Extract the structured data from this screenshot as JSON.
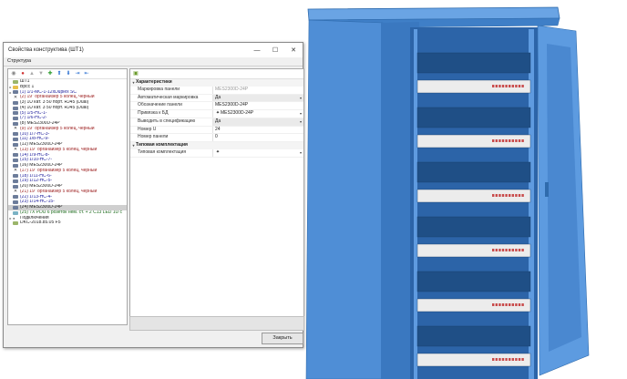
{
  "window": {
    "title": "Свойства конструктива (ШТ1)",
    "minimize": "—",
    "maximize": "☐",
    "close": "✕",
    "section": "Структура",
    "close_button": "Закрыть"
  },
  "tree": [
    {
      "tog": "",
      "ico": "doc",
      "text": "ШТ1",
      "color": "#222222"
    },
    {
      "tog": "▸",
      "ico": "folder",
      "text": "Врсс 1",
      "color": "#222222"
    },
    {
      "tog": "▸",
      "ico": "rack",
      "text": "(1) 1/1-МС-1-12xDuplex SC",
      "color": "#1a1a9a"
    },
    {
      "tog": "",
      "ico": "x",
      "text": "(2) 19\" органайзер 5 колец, черный",
      "color": "#9a1a1a"
    },
    {
      "tog": "",
      "ico": "rack",
      "text": "(3) 1U кат. 3 50 порт. RJ45 (Dual)",
      "color": "#222222"
    },
    {
      "tog": "",
      "ico": "rack",
      "text": "(4) 1U кат. 3 50 порт. RJ45 (Dual)",
      "color": "#222222"
    },
    {
      "tog": "",
      "ico": "rack",
      "text": "(5) 1/5-НС-1-",
      "color": "#1a1a9a"
    },
    {
      "tog": "",
      "ico": "rack",
      "text": "(7) 1/6-НС-2-",
      "color": "#1a1a9a"
    },
    {
      "tog": "",
      "ico": "rack",
      "text": "(8) MES2300D-24P",
      "color": "#222222"
    },
    {
      "tog": "",
      "ico": "x",
      "text": "(9) 19\" органайзер 5 колец, черный",
      "color": "#9a1a1a"
    },
    {
      "tog": "",
      "ico": "rack",
      "text": "(10) 1/7-НС-3-",
      "color": "#1a1a9a"
    },
    {
      "tog": "",
      "ico": "rack",
      "text": "(11) 1/8-НС-9-",
      "color": "#1a1a9a"
    },
    {
      "tog": "",
      "ico": "rack",
      "text": "(12) MES2300D-24P",
      "color": "#222222"
    },
    {
      "tog": "",
      "ico": "x",
      "text": "(13) 19\" органайзер 5 колец, черный",
      "color": "#9a1a1a"
    },
    {
      "tog": "",
      "ico": "rack",
      "text": "(14) 1/9-НС-8-",
      "color": "#1a1a9a"
    },
    {
      "tog": "",
      "ico": "rack",
      "text": "(15) 1/10-НС-7-",
      "color": "#1a1a9a"
    },
    {
      "tog": "",
      "ico": "rack",
      "text": "(16) MES2300D-24P",
      "color": "#222222"
    },
    {
      "tog": "",
      "ico": "x",
      "text": "(17) 19\" органайзер 5 колец, черный",
      "color": "#9a1a1a"
    },
    {
      "tog": "",
      "ico": "rack",
      "text": "(18) 1/11-НС-6-",
      "color": "#1a1a9a"
    },
    {
      "tog": "",
      "ico": "rack",
      "text": "(19) 1/12-НС-5-",
      "color": "#1a1a9a"
    },
    {
      "tog": "",
      "ico": "rack",
      "text": "(20) MES2300D-24P",
      "color": "#222222"
    },
    {
      "tog": "",
      "ico": "x",
      "text": "(21) 19\" органайзер 5 колец, черный",
      "color": "#9a1a1a"
    },
    {
      "tog": "",
      "ico": "rack",
      "text": "(22) 1/13-НС-4-",
      "color": "#1a1a9a"
    },
    {
      "tog": "",
      "ico": "rack",
      "text": "(23) 1/14-НС-15-",
      "color": "#1a1a9a"
    },
    {
      "tog": "",
      "ico": "rack",
      "text": "(24) MES2300D-24P",
      "color": "#222222",
      "selected": true
    },
    {
      "tog": "",
      "ico": "pdu",
      "text": "(25) 7X PDU 6 розеток нем. ст. + 2 C13 LED 1U с",
      "color": "#1a6a1a"
    },
    {
      "tog": "▸",
      "ico": "conn",
      "text": "Подключения",
      "color": "#222222"
    },
    {
      "tog": "",
      "ico": "doc",
      "text": "DKC-2018.85.05 F5",
      "color": "#222222"
    }
  ],
  "properties": {
    "section1": "Характеристики",
    "section2": "Типовая комплектация",
    "rows": [
      {
        "name": "Маркировка панели",
        "value": "MES2300D-24P",
        "readonly": true
      },
      {
        "name": "Автоматическая маркировка",
        "value": "Да",
        "combo": true,
        "arrow": true
      },
      {
        "name": "Обозначение панели",
        "value": "MES2300D-24P"
      },
      {
        "name": "Привязка к БД",
        "value": "MES2300D-24P",
        "marker": "✦",
        "arrow": true
      },
      {
        "name": "Выводить в спецификацию",
        "value": "Да",
        "combo": true,
        "arrow": true
      },
      {
        "name": "Номер U",
        "value": "24"
      },
      {
        "name": "Номер панели",
        "value": "0"
      }
    ],
    "kit_row": {
      "name": "Типовая комплектация",
      "value": "",
      "marker": "✦",
      "arrow": true
    }
  },
  "icons": {
    "toolbar": [
      "collapse-icon",
      "delete-icon",
      "move-up-icon",
      "move-down-icon",
      "add-icon",
      "up-icon",
      "down-icon",
      "export-icon",
      "import-icon"
    ],
    "props_toolbar": "properties-icon"
  },
  "colors": {
    "cabinet_body": "#4f8ed6",
    "cabinet_dark": "#1f4f86",
    "panel_bezel": "#ececec"
  }
}
